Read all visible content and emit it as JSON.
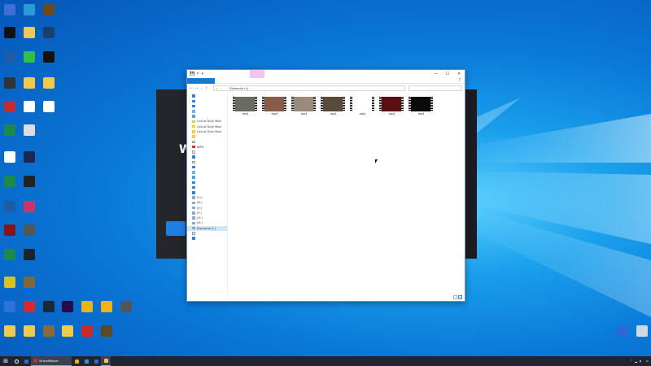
{
  "desktop": {
    "icons": [
      {
        "icon": "app-icon",
        "color": "#3d6fd6",
        "label": ""
      },
      {
        "icon": "app-icon",
        "color": "#2a9bd8",
        "label": ""
      },
      {
        "icon": "app-icon",
        "color": "#6b4a1e",
        "label": ""
      },
      {
        "icon": "capcut-icon",
        "color": "#111111",
        "label": ""
      },
      {
        "icon": "folder-icon",
        "color": "#f3c94a",
        "label": ""
      },
      {
        "icon": "app-icon",
        "color": "#1a3e6e",
        "label": ""
      },
      {
        "icon": "app-icon",
        "color": "#1e5ca8",
        "label": ""
      },
      {
        "icon": "app-icon",
        "color": "#2fbf4a",
        "label": ""
      },
      {
        "icon": "tiktok-icon",
        "color": "#111111",
        "label": ""
      },
      {
        "icon": "app-icon",
        "color": "#333333",
        "label": ""
      },
      {
        "icon": "folder-icon",
        "color": "#f3c94a",
        "label": ""
      },
      {
        "icon": "folder-icon",
        "color": "#f3c94a",
        "label": ""
      },
      {
        "icon": "app-icon",
        "color": "#c92a2a",
        "label": ""
      },
      {
        "icon": "document-icon",
        "color": "#ffffff",
        "label": ""
      },
      {
        "icon": "app-icon",
        "color": "#ffffff",
        "label": ""
      },
      {
        "icon": "spreadsheet-icon",
        "color": "#1e8a4a",
        "label": ""
      },
      {
        "icon": "app-icon",
        "color": "#dddddd",
        "label": ""
      },
      {
        "icon": "document-icon",
        "color": "#ffffff",
        "label": ""
      },
      {
        "icon": "app-icon",
        "color": "#1a2a4e",
        "label": ""
      },
      {
        "icon": "spreadsheet-icon",
        "color": "#1e8a4a",
        "label": ""
      },
      {
        "icon": "app-icon",
        "color": "#222222",
        "label": ""
      },
      {
        "icon": "app-icon",
        "color": "#1e5ca8",
        "label": ""
      },
      {
        "icon": "app-icon",
        "color": "#cc3366",
        "label": ""
      },
      {
        "icon": "app-icon",
        "color": "#8a1414",
        "label": ""
      },
      {
        "icon": "app-icon",
        "color": "#555555",
        "label": ""
      },
      {
        "icon": "spreadsheet-icon",
        "color": "#1e8a4a",
        "label": ""
      },
      {
        "icon": "app-icon",
        "color": "#222222",
        "label": ""
      },
      {
        "icon": "app-icon",
        "color": "#d9c21c",
        "label": ""
      },
      {
        "icon": "app-icon",
        "color": "#7a6a3a",
        "label": ""
      },
      {
        "icon": "app-icon",
        "color": "#2a73d8",
        "label": ""
      },
      {
        "icon": "app-icon",
        "color": "#d82a2a",
        "label": ""
      },
      {
        "icon": "steam-icon",
        "color": "#1b2838",
        "label": ""
      },
      {
        "icon": "premiere-icon",
        "color": "#2a0a4a",
        "label": ""
      },
      {
        "icon": "chrome-icon",
        "color": "#e8b21a",
        "label": ""
      },
      {
        "icon": "app-icon",
        "color": "#f0b41a",
        "label": ""
      },
      {
        "icon": "app-icon",
        "color": "#555555",
        "label": ""
      },
      {
        "icon": "folder-icon",
        "color": "#f3c94a",
        "label": ""
      },
      {
        "icon": "folder-icon",
        "color": "#f3c94a",
        "label": ""
      },
      {
        "icon": "app-icon",
        "color": "#8a6a3a",
        "label": ""
      },
      {
        "icon": "folder-icon",
        "color": "#f3c94a",
        "label": ""
      },
      {
        "icon": "app-icon",
        "color": "#c82a2a",
        "label": ""
      },
      {
        "icon": "app-icon",
        "color": "#5a4a2a",
        "label": ""
      }
    ],
    "right_icons": [
      {
        "icon": "wallpaper-engine-icon",
        "color": "#2a6ad8",
        "label": ""
      },
      {
        "icon": "recycle-bin-icon",
        "color": "#cfd8e0",
        "label": ""
      }
    ]
  },
  "dark_app": {
    "big_letter": "W"
  },
  "explorer": {
    "title": "",
    "manage_tab": "",
    "quick_access": [
      "💾",
      "↶",
      "▾"
    ],
    "window_controls": [
      "—",
      "☐",
      "✕"
    ],
    "ribbon_tabs": [
      {
        "label": "",
        "kind": "file"
      },
      {
        "label": "",
        "kind": "normal"
      },
      {
        "label": "",
        "kind": "normal"
      },
      {
        "label": "",
        "kind": "normal"
      },
      {
        "label": "",
        "kind": "sub"
      }
    ],
    "help": "?",
    "nav_buttons": [
      "←",
      "→",
      "⌄",
      "↑"
    ],
    "path": [
      "",
      "Elements (I:)",
      ""
    ],
    "search_placeholder": "",
    "nav_items": [
      {
        "label": "",
        "color": "#2b84d8",
        "selected": false
      },
      {
        "label": "",
        "color": "#3a7bd5",
        "selected": false
      },
      {
        "label": "",
        "color": "#2b84d8",
        "selected": false
      },
      {
        "label": "",
        "color": "#7ab0e0",
        "selected": false
      },
      {
        "label": "",
        "color": "#4aa0e0",
        "selected": false
      },
      {
        "label": "Call of Duty  Mod",
        "color": "#f3c94a",
        "selected": false
      },
      {
        "label": "Call of Duty  Mod",
        "color": "#f3c94a",
        "selected": false
      },
      {
        "label": "Call of Duty  Mod",
        "color": "#f3c94a",
        "selected": false
      },
      {
        "label": "",
        "color": "#f3c94a",
        "selected": false
      },
      {
        "label": "",
        "color": "#ffffff",
        "selected": false
      },
      {
        "label": "WPS",
        "color": "#d82a2a",
        "selected": false
      },
      {
        "label": "",
        "color": "#ffffff",
        "selected": false
      },
      {
        "label": "",
        "color": "#3a7bd5",
        "selected": false
      },
      {
        "label": "",
        "color": "#ffffff",
        "selected": false
      },
      {
        "label": "",
        "color": "#3a7bd5",
        "selected": false
      },
      {
        "label": "",
        "color": "#7ab0e0",
        "selected": false
      },
      {
        "label": "",
        "color": "#4aa0e0",
        "selected": false
      },
      {
        "label": "",
        "color": "#2b84d8",
        "selected": false
      },
      {
        "label": "",
        "color": "#3a7bd5",
        "selected": false
      },
      {
        "label": "",
        "color": "#2b84d8",
        "selected": false
      },
      {
        "label": "(C:)",
        "color": "#8aa8c8",
        "selected": false
      },
      {
        "label": "(D:)",
        "color": "#8aa8c8",
        "selected": false
      },
      {
        "label": "(E:)",
        "color": "#8aa8c8",
        "selected": false
      },
      {
        "label": "(F:)",
        "color": "#8aa8c8",
        "selected": false
      },
      {
        "label": "(G:)",
        "color": "#8aa8c8",
        "selected": false
      },
      {
        "label": "(H:)",
        "color": "#8aa8c8",
        "selected": false
      },
      {
        "label": "Elements (I:)",
        "color": "#8aa8c8",
        "selected": true
      },
      {
        "label": "",
        "color": "#ffffff",
        "selected": false
      },
      {
        "label": "",
        "color": "#2b84d8",
        "selected": false
      }
    ],
    "files": [
      {
        "name": ".mp4",
        "thumb": "#6a6a60"
      },
      {
        "name": ".mp4",
        "thumb": "#8a5a4a"
      },
      {
        "name": ".mp4",
        "thumb": "#9a8a7a"
      },
      {
        "name": ".mp4",
        "thumb": "#5a4a3a"
      },
      {
        "name": ".mp4",
        "thumb": "#ffffff"
      },
      {
        "name": ".mp4",
        "thumb": "#5a1010"
      },
      {
        "name": ".mp4",
        "thumb": "#0a0a0a"
      }
    ],
    "status": ""
  },
  "taskbar": {
    "start_icon": "⊞",
    "items": [
      {
        "icon": "search-icon",
        "label": "",
        "color": "#ffffff",
        "active": false
      },
      {
        "icon": "app-icon",
        "label": "",
        "color": "#2a6ad8",
        "active": false
      },
      {
        "icon": "app-icon",
        "label": "VirtualMaster",
        "color": "#c82a2a",
        "active": true
      },
      {
        "icon": "chrome-icon",
        "label": "",
        "color": "#e8b21a",
        "active": false
      },
      {
        "icon": "app-icon",
        "label": "",
        "color": "#2a9bd8",
        "active": false
      },
      {
        "icon": "app-icon",
        "label": "",
        "color": "#2a6ad8",
        "active": false
      },
      {
        "icon": "folder-icon",
        "label": "",
        "color": "#f3c94a",
        "active": true
      }
    ],
    "tray": {
      "time": "",
      "date": ""
    }
  }
}
